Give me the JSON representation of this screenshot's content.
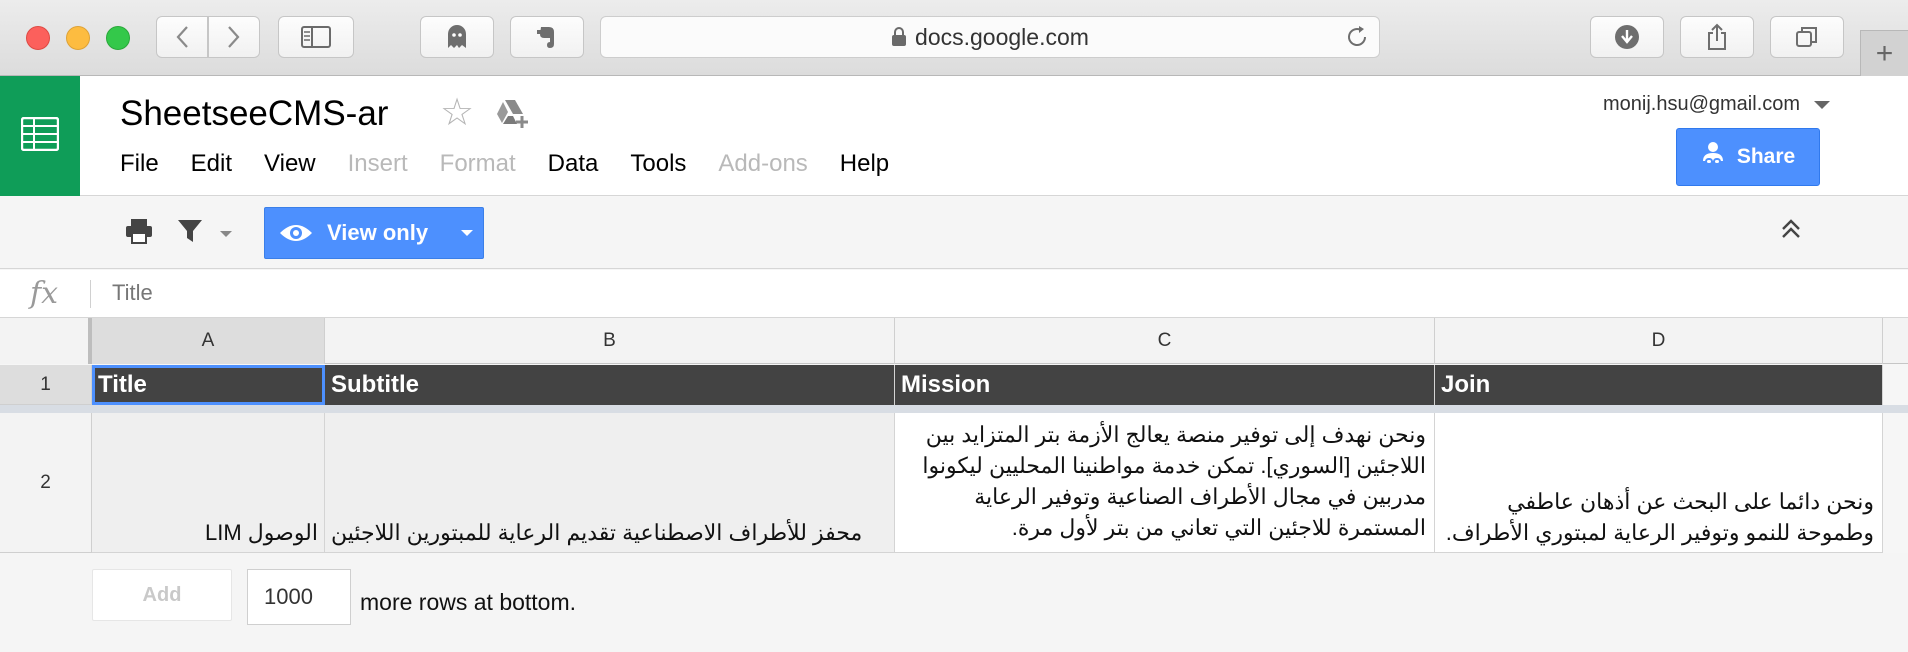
{
  "browser": {
    "url": "docs.google.com",
    "icons": {
      "back": "chevron-left-icon",
      "forward": "chevron-right-icon",
      "sidebar": "sidebar-icon",
      "ghost": "ghost-icon",
      "evernote": "evernote-icon",
      "download": "download-icon",
      "share": "share-icon",
      "tabs": "tabs-icon",
      "new_tab": "+"
    }
  },
  "sheet": {
    "title": "SheetseeCMS-ar",
    "account": "monij.hsu@gmail.com",
    "share_label": "Share",
    "menu": [
      {
        "label": "File",
        "enabled": true
      },
      {
        "label": "Edit",
        "enabled": true
      },
      {
        "label": "View",
        "enabled": true
      },
      {
        "label": "Insert",
        "enabled": false
      },
      {
        "label": "Format",
        "enabled": false
      },
      {
        "label": "Data",
        "enabled": true
      },
      {
        "label": "Tools",
        "enabled": true
      },
      {
        "label": "Add-ons",
        "enabled": false
      },
      {
        "label": "Help",
        "enabled": true
      }
    ],
    "view_only_label": "View only",
    "accent_color": "#4d90fe",
    "brand_color": "#0f9d58"
  },
  "formula": {
    "fx": "fx",
    "value": "Title"
  },
  "grid": {
    "columns": [
      "A",
      "B",
      "C",
      "D"
    ],
    "row_numbers": [
      "1",
      "2"
    ],
    "header_row": [
      "Title",
      "Subtitle",
      "Mission",
      "Join"
    ],
    "row2": {
      "a": "الوصول LIM",
      "b": "محفز للأطراف الاصطناعية تقديم الرعاية للمبتورين اللاجئين",
      "c": "ونحن نهدف إلى توفير منصة يعالج الأزمة بتر المتزايد بين اللاجئين [السوري]. تمكن خدمة مواطنينا المحليين ليكونوا مدربين في مجال الأطراف الصناعية وتوفير الرعاية المستمرة للاجئين التي تعاني من بتر لأول مرة.",
      "d": "ونحن دائما على البحث عن أذهان عاطفي وطموحة للنمو وتوفير الرعاية لمبتوري الأطراف."
    }
  },
  "footer": {
    "add_label": "Add",
    "rows_value": "1000",
    "rows_suffix": "more rows at bottom."
  }
}
